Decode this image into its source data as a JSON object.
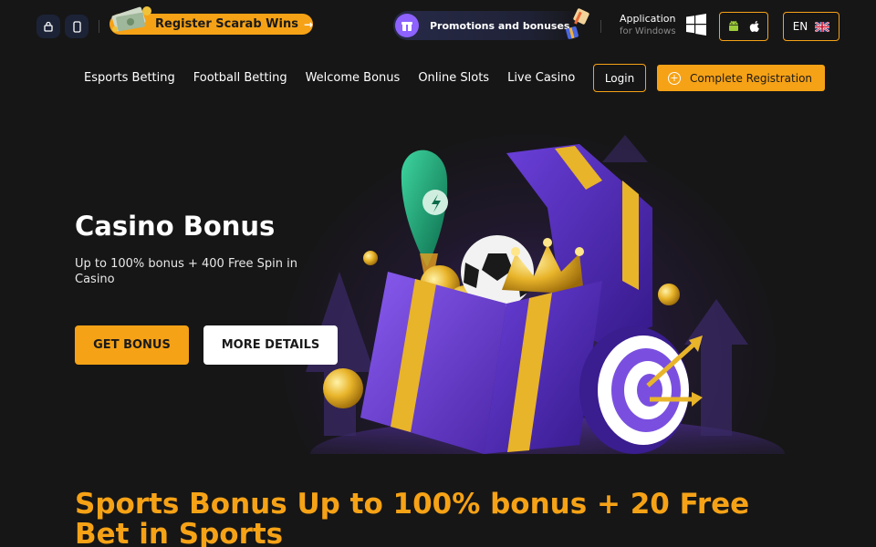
{
  "header": {
    "register_promo": "Register Scarab Wins",
    "register_arrow": "→",
    "promotions": "Promotions and bonuses",
    "app_title": "Application",
    "app_subtitle": "for Windows",
    "language": "EN"
  },
  "nav": {
    "items": [
      {
        "label": "Esports Betting"
      },
      {
        "label": "Football Betting"
      },
      {
        "label": "Welcome Bonus"
      },
      {
        "label": "Online Slots"
      },
      {
        "label": "Live Casino"
      }
    ],
    "login": "Login",
    "complete_registration": "Complete Registration",
    "plus_symbol": "+"
  },
  "hero": {
    "title": "Casino Bonus",
    "subtitle": "Up to 100% bonus + 400 Free Spin in Casino",
    "get_bonus": "GET BONUS",
    "more_details": "MORE DETAILS"
  },
  "sports": {
    "title": "Sports Bonus Up to 100% bonus + 20 Free Bet in Sports"
  },
  "colors": {
    "accent": "#f6a216",
    "background": "#161616",
    "purple": "#6b3fd4"
  }
}
